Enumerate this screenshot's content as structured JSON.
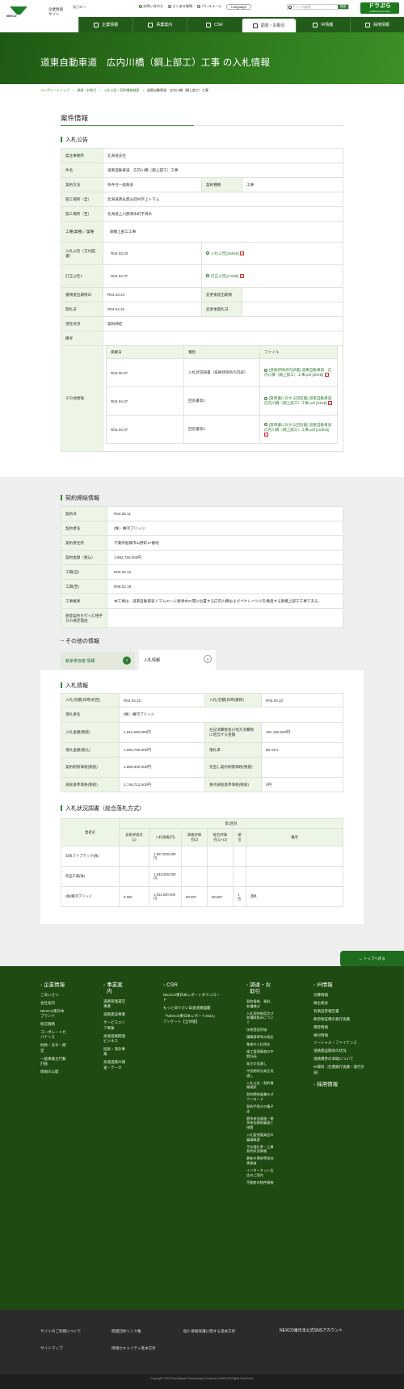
{
  "header": {
    "logo_text": "NEXCO",
    "corp_title_1": "企業情報",
    "corp_title_2": "サイト",
    "corp_site_link": "東日本へ",
    "links": [
      "お問い合わせ",
      "よくある質問",
      "プレスルーム",
      "Language"
    ],
    "search_placeholder": "サイト内検索",
    "search_btn": "検索",
    "dora": "ドラぷら",
    "dora_sub": "E-NEXCO Drive Plaza"
  },
  "gnav": [
    "企業情報",
    "事業案内",
    "CSR",
    "調達・お取引",
    "IR情報",
    "採用情報"
  ],
  "page_title": "道東自動車道　広内川橋（鋼上部工）工事 の入札情報",
  "breadcrumb": [
    "コーポレートトップ",
    "調達・お取引",
    "入札公告・契約情報検索",
    "道東自動車道　広内川橋（鋼上部工）工事"
  ],
  "section_title": "案件情報",
  "notice": {
    "heading": "入札公告",
    "rows": {
      "org_label": "発注事務所",
      "org": "北海道支社",
      "name_label": "件名",
      "name": "道東自動車道　広内川橋（鋼上部工）工事",
      "method_label": "契約方法",
      "method": "条件付一般競争",
      "kind_label": "契約種類",
      "kind": "工事",
      "place_from_label": "施工場所（自）",
      "place_from": "北海道勇払郡占冠村字上トマム",
      "place_to_label": "施工場所（至）",
      "place_to": "北海道上川郡清水町字清水",
      "type_label": "工種(業種)／業種",
      "type": "鋼橋上部工工事",
      "announce_label": "入札公告（交付図書）",
      "announce_date": "R04.03.03",
      "announce_file": "入札公告[284KB]",
      "correct_label": "訂正公告1",
      "correct_date": "R04.04.07",
      "correct_file": "訂正公告[3.2MB]",
      "doc_deadline_label": "書類提出期限日",
      "doc_deadline": "R04.03.24",
      "doc_deadline_after_label": "変更後提出期限",
      "open_label": "開札日",
      "open": "R04.04.22",
      "open_after_label": "変更後開札日",
      "progress_label": "現在状況",
      "progress": "契約締結",
      "remarks_label": "備考",
      "other_label": "その他情報"
    },
    "other_headers": [
      "掲載日",
      "種別",
      "ファイル"
    ],
    "other_rows": [
      {
        "date": "R04.06.07",
        "kind": "入札状況調書（技術評価点の内訳）",
        "file": "[技術評価点内訳書] 道東自動車道　広内川橋（鋼上部工）工事.pdf [56KB]"
      },
      {
        "date": "R04.04.07",
        "kind": "回答書等1",
        "file": "[質問書に対する回答書] 道東自動車道　広内川橋（鋼上部工）工事.pdf [53KB]"
      },
      {
        "date": "R04.04.07",
        "kind": "回答書等2",
        "file": "[質問書に対する回答書] 道東自動車道　広内川橋（鋼上部工）工事.pdf [108KB]"
      }
    ]
  },
  "contract": {
    "heading": "契約締結情報",
    "rows": [
      {
        "label": "契約日",
        "value": "R04.05.11"
      },
      {
        "label": "契約者名",
        "value": "(株）横河ブリッジ"
      },
      {
        "label": "契約者住所",
        "value": "千葉県船橋市山野町27番地"
      },
      {
        "label": "契約金額（税込）",
        "value": "1,992,760,000円"
      },
      {
        "label": "工期(自)",
        "value": "R04.05.12"
      },
      {
        "label": "工期(至)",
        "value": "R08.02.19"
      },
      {
        "label": "工事概要",
        "value": "本工事は、道東自動車道トマムIC～十勝清水IC間に位置する広内川橋およびペケレベツ川を横過する鋼橋上部工工事である。"
      },
      {
        "label": "随意契約を行った相手方の選定理由",
        "value": ""
      }
    ]
  },
  "other_info_title": "その他の情報",
  "tabs": [
    {
      "label": "競争参加者 情報",
      "num": "1"
    },
    {
      "label": "入札情報",
      "num": "2"
    }
  ],
  "bid": {
    "heading": "入札情報",
    "rows": [
      {
        "l1": "入札(見積)日時(初回)",
        "v1": "R04.04.22",
        "l2": "入札(見積)日時(最終)",
        "v2": "R04.04.22"
      },
      {
        "l1": "落札者名",
        "v1": "(株）横河ブリッジ"
      },
      {
        "l1": "入札金額(税抜)",
        "v1": "1,811,600,000円",
        "l2": "左記消費税及び地方消費税に相当する金額",
        "v2": "181,160,000円"
      },
      {
        "l1": "落札金額(税込)",
        "v1": "1,992,760,000円",
        "l2": "落札率",
        "v2": "85.41%"
      },
      {
        "l1": "契約制限価格(税抜)",
        "v1": "1,886,600,000円",
        "l2": "見直し契約制限価格(税抜)",
        "v2": ""
      },
      {
        "l1": "調査基準価格(税抜)",
        "v1": "1,746,712,000円",
        "l2": "重点調査基準価格(税抜)",
        "v2": "0円"
      }
    ]
  },
  "status": {
    "heading": "入札状況調書（総合落札方式）",
    "col_company": "業者名",
    "col_round": "第1回目",
    "sub_headers": [
      "技術評価点(1)",
      "入札価格(円)",
      "価格評価点(2)",
      "総合評価点(1)+(2)",
      "順位",
      "備考"
    ],
    "rows": [
      {
        "name": "日本ファブテック(株)",
        "tech": "",
        "price": "1,907,000,000円",
        "pscore": "",
        "total": "",
        "rank": "",
        "note": ""
      },
      {
        "name": "矢田工業(株)",
        "tech": "",
        "price": "1,933,000,000円",
        "pscore": "",
        "total": "",
        "rank": "",
        "note": ""
      },
      {
        "name": "(株)横河ブリッジ",
        "tech": "9.500",
        "price": "1,811,600,000円",
        "pscore": "89.087",
        "total": "98.587",
        "rank": "1位",
        "note": "落札"
      }
    ]
  },
  "backtop": "トップへ戻る",
  "footer": {
    "cols": [
      {
        "title": "企業情報",
        "items": [
          "ごあいさつ",
          "会社案内",
          "NEXCO東日本ブランド",
          "経営戦略",
          "コーポレートガバナンス",
          "約款・法令・規定",
          "一般事業主行動計画",
          "情報の公開"
        ]
      },
      {
        "title": "事業案内",
        "items": [
          "道路管理運営事業",
          "道路建設事業",
          "サービスエリア事業",
          "高速道路関連ビジネス",
          "技術・海外事業",
          "高速道路の調査・データ"
        ]
      },
      {
        "title": "CSR",
        "items": [
          "NEXCO東日本レポートダウンロード",
          "もっと知りたい高速道路図鑑",
          "「NEXCO東日本レポート2022」アンケート【全体版】"
        ]
      },
      {
        "title": "調達・お取引",
        "items": [
          "契約情報、資料、各種様式",
          "入札契約制度及び各種取組みについて",
          "技術提案評価",
          "積算基準等の改定",
          "業者の入札指名",
          "施工管理事務の中期計画",
          "発注の見通し",
          "中長期的な発注見通し",
          "入札公告・契約情報検索",
          "契約関係図書のダウンロード",
          "契約手続きの電子化",
          "競争参加資格・競争参加資格審査と措置",
          "入札監視委員会の審議概要",
          "平均落札率・工事契約状況情報",
          "最新の事故等発効事業者",
          "インターネット広告のご案内",
          "不動産の物件情報"
        ]
      },
      {
        "title": "IR情報",
        "items": [
          "決算情報",
          "株主総会",
          "有価証券報告書",
          "政府保証債の発行実績",
          "債券情報",
          "格付情報",
          "ソーシャル・ファイナンス",
          "道路建設関係の状況",
          "道路債券の承継について",
          "IR資料（社債発行実績・発行計画）"
        ]
      }
    ],
    "recruit": "採用情報",
    "bottom_links": [
      "サイトのご利用について",
      "関連団体リンク集",
      "個人情報保護に関する基本方針",
      "NEXCO東日本公式SNSアカウント",
      "サイトマップ",
      "情報セキュリティ基本方針"
    ],
    "copyright": "Copyright 2022 East Nippon Expressway Company Limited All Rights Reserved."
  },
  "colors": {
    "brand": "#235c1a",
    "accent": "#2f8a2f",
    "th_bg": "#edf6e6"
  }
}
